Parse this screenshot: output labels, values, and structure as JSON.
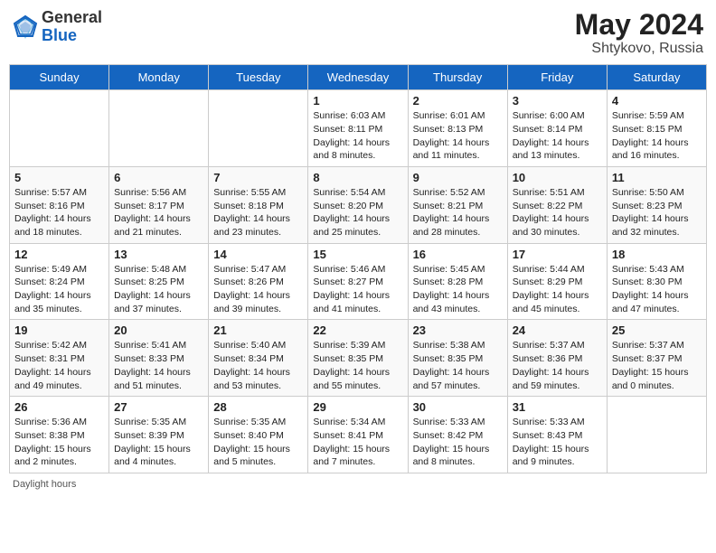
{
  "header": {
    "logo_general": "General",
    "logo_blue": "Blue",
    "month_year": "May 2024",
    "location": "Shtykovo, Russia"
  },
  "weekdays": [
    "Sunday",
    "Monday",
    "Tuesday",
    "Wednesday",
    "Thursday",
    "Friday",
    "Saturday"
  ],
  "weeks": [
    [
      {
        "day": "",
        "info": ""
      },
      {
        "day": "",
        "info": ""
      },
      {
        "day": "",
        "info": ""
      },
      {
        "day": "1",
        "info": "Sunrise: 6:03 AM\nSunset: 8:11 PM\nDaylight: 14 hours\nand 8 minutes."
      },
      {
        "day": "2",
        "info": "Sunrise: 6:01 AM\nSunset: 8:13 PM\nDaylight: 14 hours\nand 11 minutes."
      },
      {
        "day": "3",
        "info": "Sunrise: 6:00 AM\nSunset: 8:14 PM\nDaylight: 14 hours\nand 13 minutes."
      },
      {
        "day": "4",
        "info": "Sunrise: 5:59 AM\nSunset: 8:15 PM\nDaylight: 14 hours\nand 16 minutes."
      }
    ],
    [
      {
        "day": "5",
        "info": "Sunrise: 5:57 AM\nSunset: 8:16 PM\nDaylight: 14 hours\nand 18 minutes."
      },
      {
        "day": "6",
        "info": "Sunrise: 5:56 AM\nSunset: 8:17 PM\nDaylight: 14 hours\nand 21 minutes."
      },
      {
        "day": "7",
        "info": "Sunrise: 5:55 AM\nSunset: 8:18 PM\nDaylight: 14 hours\nand 23 minutes."
      },
      {
        "day": "8",
        "info": "Sunrise: 5:54 AM\nSunset: 8:20 PM\nDaylight: 14 hours\nand 25 minutes."
      },
      {
        "day": "9",
        "info": "Sunrise: 5:52 AM\nSunset: 8:21 PM\nDaylight: 14 hours\nand 28 minutes."
      },
      {
        "day": "10",
        "info": "Sunrise: 5:51 AM\nSunset: 8:22 PM\nDaylight: 14 hours\nand 30 minutes."
      },
      {
        "day": "11",
        "info": "Sunrise: 5:50 AM\nSunset: 8:23 PM\nDaylight: 14 hours\nand 32 minutes."
      }
    ],
    [
      {
        "day": "12",
        "info": "Sunrise: 5:49 AM\nSunset: 8:24 PM\nDaylight: 14 hours\nand 35 minutes."
      },
      {
        "day": "13",
        "info": "Sunrise: 5:48 AM\nSunset: 8:25 PM\nDaylight: 14 hours\nand 37 minutes."
      },
      {
        "day": "14",
        "info": "Sunrise: 5:47 AM\nSunset: 8:26 PM\nDaylight: 14 hours\nand 39 minutes."
      },
      {
        "day": "15",
        "info": "Sunrise: 5:46 AM\nSunset: 8:27 PM\nDaylight: 14 hours\nand 41 minutes."
      },
      {
        "day": "16",
        "info": "Sunrise: 5:45 AM\nSunset: 8:28 PM\nDaylight: 14 hours\nand 43 minutes."
      },
      {
        "day": "17",
        "info": "Sunrise: 5:44 AM\nSunset: 8:29 PM\nDaylight: 14 hours\nand 45 minutes."
      },
      {
        "day": "18",
        "info": "Sunrise: 5:43 AM\nSunset: 8:30 PM\nDaylight: 14 hours\nand 47 minutes."
      }
    ],
    [
      {
        "day": "19",
        "info": "Sunrise: 5:42 AM\nSunset: 8:31 PM\nDaylight: 14 hours\nand 49 minutes."
      },
      {
        "day": "20",
        "info": "Sunrise: 5:41 AM\nSunset: 8:33 PM\nDaylight: 14 hours\nand 51 minutes."
      },
      {
        "day": "21",
        "info": "Sunrise: 5:40 AM\nSunset: 8:34 PM\nDaylight: 14 hours\nand 53 minutes."
      },
      {
        "day": "22",
        "info": "Sunrise: 5:39 AM\nSunset: 8:35 PM\nDaylight: 14 hours\nand 55 minutes."
      },
      {
        "day": "23",
        "info": "Sunrise: 5:38 AM\nSunset: 8:35 PM\nDaylight: 14 hours\nand 57 minutes."
      },
      {
        "day": "24",
        "info": "Sunrise: 5:37 AM\nSunset: 8:36 PM\nDaylight: 14 hours\nand 59 minutes."
      },
      {
        "day": "25",
        "info": "Sunrise: 5:37 AM\nSunset: 8:37 PM\nDaylight: 15 hours\nand 0 minutes."
      }
    ],
    [
      {
        "day": "26",
        "info": "Sunrise: 5:36 AM\nSunset: 8:38 PM\nDaylight: 15 hours\nand 2 minutes."
      },
      {
        "day": "27",
        "info": "Sunrise: 5:35 AM\nSunset: 8:39 PM\nDaylight: 15 hours\nand 4 minutes."
      },
      {
        "day": "28",
        "info": "Sunrise: 5:35 AM\nSunset: 8:40 PM\nDaylight: 15 hours\nand 5 minutes."
      },
      {
        "day": "29",
        "info": "Sunrise: 5:34 AM\nSunset: 8:41 PM\nDaylight: 15 hours\nand 7 minutes."
      },
      {
        "day": "30",
        "info": "Sunrise: 5:33 AM\nSunset: 8:42 PM\nDaylight: 15 hours\nand 8 minutes."
      },
      {
        "day": "31",
        "info": "Sunrise: 5:33 AM\nSunset: 8:43 PM\nDaylight: 15 hours\nand 9 minutes."
      },
      {
        "day": "",
        "info": ""
      }
    ]
  ],
  "footer": {
    "note": "Daylight hours"
  }
}
